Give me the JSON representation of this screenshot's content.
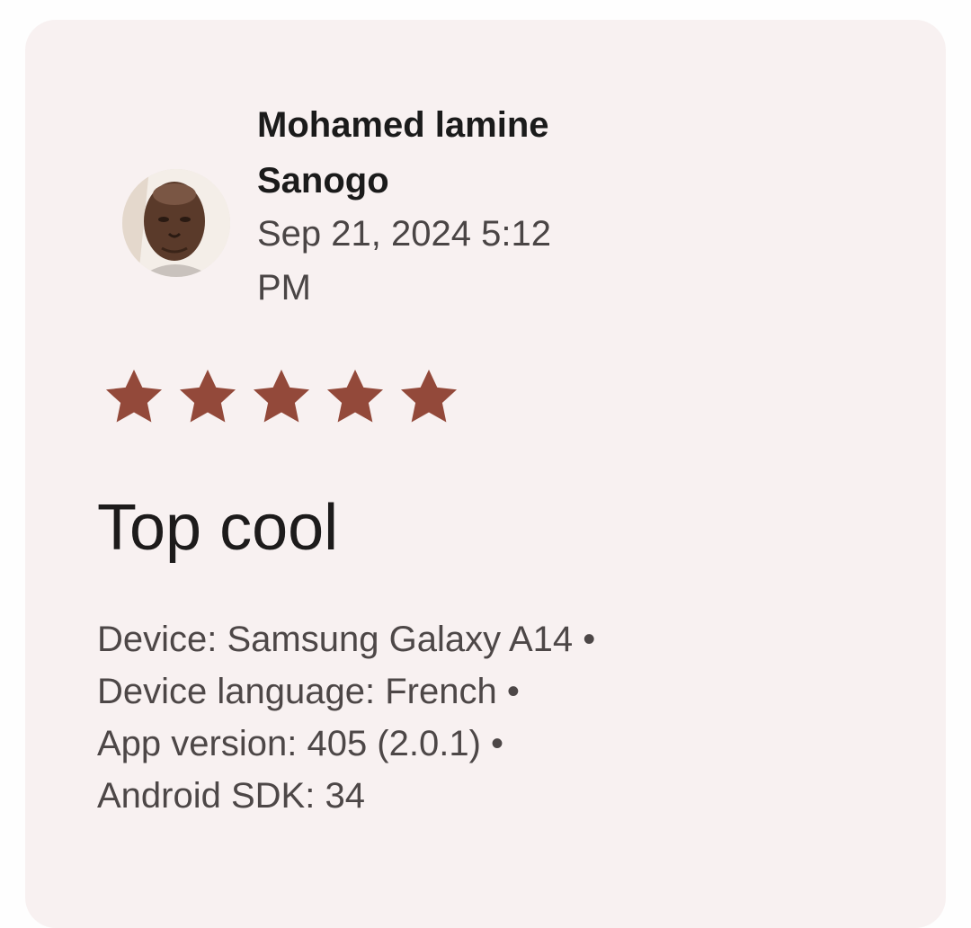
{
  "review": {
    "author_line1": "Mohamed lamine",
    "author_line2": "Sanogo",
    "date_line1": "Sep 21, 2024 5:12",
    "date_line2": "PM",
    "rating": 5,
    "rating_max": 5,
    "star_color": "#93493a",
    "title": "Top cool",
    "details": [
      "Device: Samsung Galaxy A14 •",
      "Device language: French •",
      "App version: 405 (2.0.1) •",
      "Android SDK: 34"
    ]
  },
  "avatar_icon": "user-photo-icon",
  "colors": {
    "card_background": "#f8f1f1",
    "text_primary": "#1b1b1b",
    "text_secondary": "#4a4545"
  }
}
